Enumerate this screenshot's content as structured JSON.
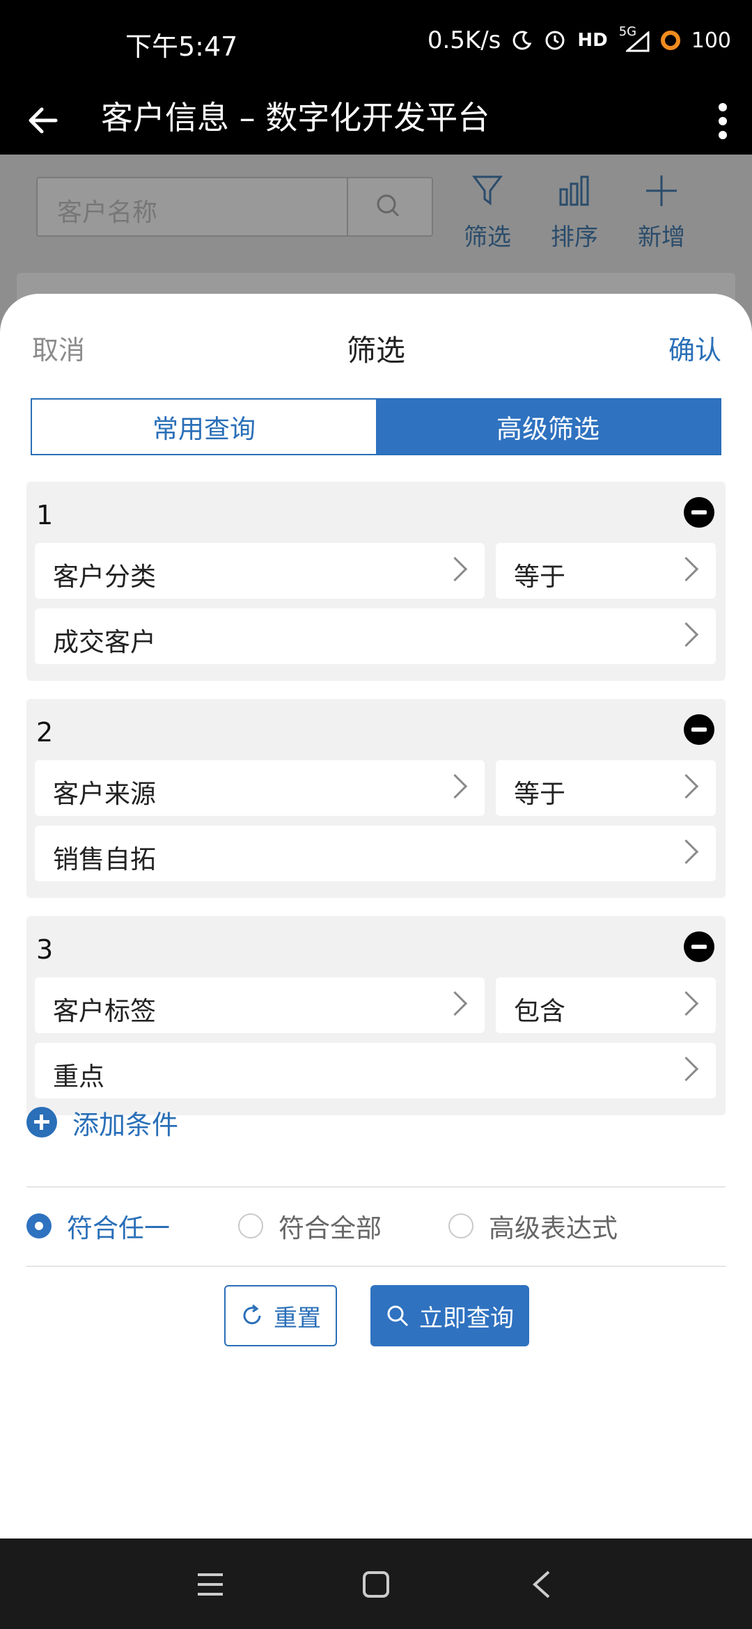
{
  "status_bar": {
    "time": "下午5:47",
    "net_speed": "0.5K/s",
    "hd": "HD",
    "signal": "5G",
    "battery": "100",
    "icons": [
      "moon-icon",
      "alarm-icon",
      "hd-icon",
      "signal-5g-icon",
      "battery-ring-icon"
    ]
  },
  "app_bar": {
    "title": "客户信息 – 数字化开发平台"
  },
  "background_page": {
    "search_placeholder": "客户名称",
    "tools": [
      {
        "label": "筛选",
        "icon": "filter-icon"
      },
      {
        "label": "排序",
        "icon": "sort-bars-icon"
      },
      {
        "label": "新增",
        "icon": "plus-icon"
      }
    ]
  },
  "sheet": {
    "cancel": "取消",
    "title": "筛选",
    "confirm": "确认",
    "tabs": [
      {
        "label": "常用查询",
        "active": false
      },
      {
        "label": "高级筛选",
        "active": true
      }
    ],
    "conditions": [
      {
        "index": "1",
        "field": "客户分类",
        "operator": "等于",
        "value": "成交客户"
      },
      {
        "index": "2",
        "field": "客户来源",
        "operator": "等于",
        "value": "销售自拓"
      },
      {
        "index": "3",
        "field": "客户标签",
        "operator": "包含",
        "value": "重点"
      }
    ],
    "add_condition": "添加条件",
    "match_options": [
      {
        "label": "符合任一",
        "selected": true
      },
      {
        "label": "符合全部",
        "selected": false
      },
      {
        "label": "高级表达式",
        "selected": false
      }
    ],
    "reset": "重置",
    "query": "立即查询"
  },
  "colors": {
    "accent": "#2f72c0",
    "danger": "#000000",
    "battery": "#f08c1f"
  }
}
